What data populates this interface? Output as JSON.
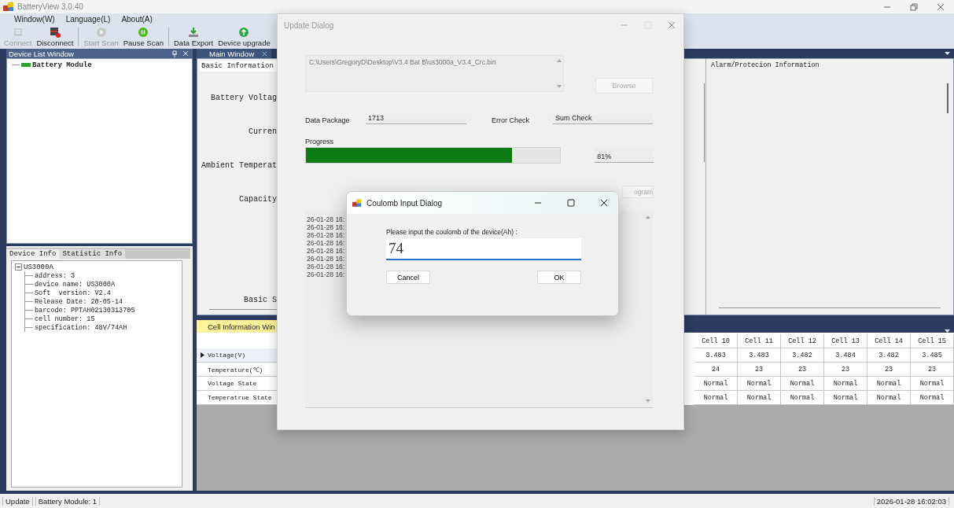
{
  "window": {
    "title": "BatteryView 3.0.40"
  },
  "menu": [
    "Window(W)",
    "Language(L)",
    "About(A)"
  ],
  "toolbar": [
    [
      {
        "label": "Connect",
        "kind": "connect",
        "disabled": true
      },
      {
        "label": "Disconnect",
        "kind": "disconnect",
        "disabled": false
      }
    ],
    [
      {
        "label": "Start Scan",
        "kind": "start",
        "disabled": true
      },
      {
        "label": "Pause Scan",
        "kind": "pause",
        "disabled": false
      }
    ],
    [
      {
        "label": "Data Export",
        "kind": "export",
        "disabled": false
      },
      {
        "label": "Device upgrade",
        "kind": "upgrade",
        "disabled": false
      }
    ]
  ],
  "device_list": {
    "title": "Device List Window",
    "items": [
      "Battery Module"
    ]
  },
  "device_info": {
    "tabs": [
      {
        "label": "Device Info",
        "selected": true
      },
      {
        "label": "Statistic Info",
        "selected": false
      }
    ],
    "tree": {
      "label": "US3000A",
      "expanded": true,
      "children": [
        {
          "label": "address: 3"
        },
        {
          "label": "device name: US3000A"
        },
        {
          "label": "Soft  version: V2.4"
        },
        {
          "label": "Release Date: 20-05-14"
        },
        {
          "label": "barcode: PPTAH02130313705"
        },
        {
          "label": "cell number: 15"
        },
        {
          "label": "specification: 48V/74AH"
        }
      ]
    }
  },
  "main_window": {
    "tab": "Main Window",
    "subtab": "Basic Information",
    "labels": [
      "Battery Voltag",
      "Curren",
      "Ambient Temperat",
      "Capacity",
      "Basic S"
    ],
    "alarm_title": "Alarm/Protecion Information"
  },
  "cell_window": {
    "tab": "Cell Information Win",
    "columns": [
      "Cell 10",
      "Cell 11",
      "Cell 12",
      "Cell 13",
      "Cell 14",
      "Cell 15"
    ],
    "rows": [
      {
        "label": "Voltage(V)",
        "current": true,
        "cells": [
          "3.483",
          "3.483",
          "3.482",
          "3.484",
          "3.482",
          "3.485"
        ]
      },
      {
        "label": "Temperature(℃)",
        "current": false,
        "cells": [
          "24",
          "23",
          "23",
          "23",
          "23",
          "23"
        ]
      },
      {
        "label": "Voltage State",
        "current": false,
        "cells": [
          "Normal",
          "Normal",
          "Normal",
          "Normal",
          "Normal",
          "Normal"
        ]
      },
      {
        "label": "Temperatrue State",
        "current": false,
        "cells": [
          "Normal",
          "Normal",
          "Normal",
          "Normal",
          "Normal",
          "Normal"
        ]
      }
    ]
  },
  "update_dialog": {
    "title": "Update Dialog",
    "file_path": "C:\\Users\\GregoryD\\Desktop\\V3.4 Bat B\\us3000a_V3.4_Crc.bin",
    "browse": {
      "label": "Browse",
      "disabled": true
    },
    "data_package_label": "Data Package",
    "data_package": "1713",
    "error_check_label": "Error Check",
    "error_check": "Sum Check",
    "progress_label": "Progress",
    "progress": {
      "level": 0.81
    },
    "percent": "81%",
    "program_button": "ogram",
    "log": [
      "26-01-28 16:",
      "26-01-28 16:",
      "26-01-28 16:",
      "26-01-28 16:",
      "26-01-28 16:",
      "26-01-28 16:",
      "26-01-28 16:",
      "26-01-28 16:"
    ]
  },
  "coulomb_dialog": {
    "title": "Coulomb Input Dialog",
    "prompt": "Please input the coulomb of the device(Ah) :",
    "value": "74",
    "buttons": [
      "Cancel",
      "OK"
    ]
  },
  "status_bar": [
    "Update",
    "Battery Module: 1"
  ],
  "clock": "2026-01-28 16:02:03"
}
